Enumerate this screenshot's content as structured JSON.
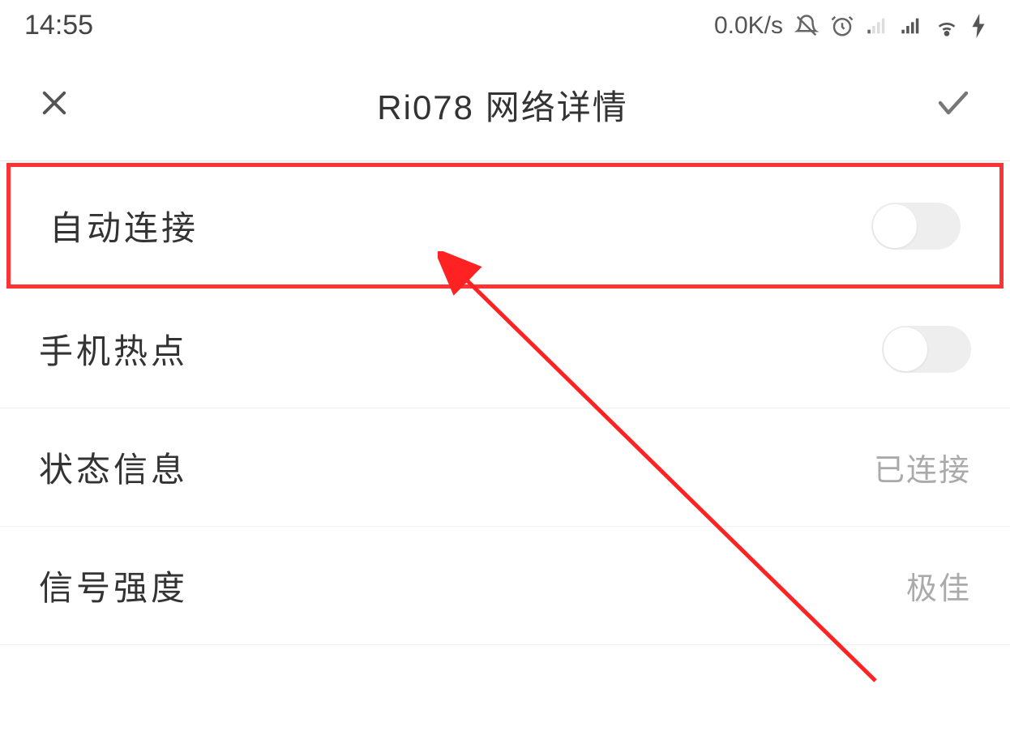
{
  "statusBar": {
    "time": "14:55",
    "networkSpeed": "0.0K/s"
  },
  "header": {
    "title": "Ri078  网络详情"
  },
  "rows": {
    "autoConnect": {
      "label": "自动连接"
    },
    "hotspot": {
      "label": "手机热点"
    },
    "statusInfo": {
      "label": "状态信息",
      "value": "已连接"
    },
    "signalStrength": {
      "label": "信号强度",
      "value": "极佳"
    }
  }
}
